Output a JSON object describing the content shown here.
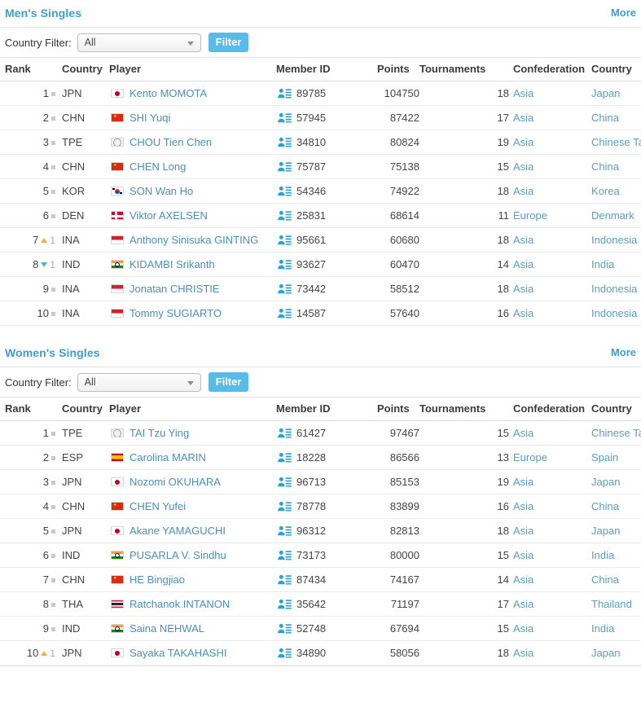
{
  "columns": [
    "Rank",
    "Country",
    "Player",
    "Member ID",
    "Points",
    "Tournaments",
    "Confederation",
    "Country"
  ],
  "filter": {
    "label": "Country Filter:",
    "selected": "All",
    "button": "Filter"
  },
  "icons": {
    "member_id": "id-card-icon",
    "dropdown": "chevron-down-icon"
  },
  "colors": {
    "accent": "#3a9fd4",
    "link": "#4a8fb8",
    "button": "#59bce8",
    "up": "#f0ad4e",
    "down": "#4ab5d1",
    "same": "#c9c9c9"
  },
  "sections": [
    {
      "title": "Men's Singles",
      "more": "More",
      "rows": [
        {
          "rank": "1",
          "move": "same",
          "amount": "",
          "code": "JPN",
          "flag": "jp",
          "player": "Kento MOMOTA",
          "member_id": "89785",
          "points": "104750",
          "tournaments": "18",
          "confederation": "Asia",
          "country": "Japan"
        },
        {
          "rank": "2",
          "move": "same",
          "amount": "",
          "code": "CHN",
          "flag": "cn",
          "player": "SHI Yuqi",
          "member_id": "57945",
          "points": "87422",
          "tournaments": "17",
          "confederation": "Asia",
          "country": "China"
        },
        {
          "rank": "3",
          "move": "same",
          "amount": "",
          "code": "TPE",
          "flag": "tw",
          "player": "CHOU Tien Chen",
          "member_id": "34810",
          "points": "80824",
          "tournaments": "19",
          "confederation": "Asia",
          "country": "Chinese Taipei"
        },
        {
          "rank": "4",
          "move": "same",
          "amount": "",
          "code": "CHN",
          "flag": "cn",
          "player": "CHEN Long",
          "member_id": "75787",
          "points": "75138",
          "tournaments": "15",
          "confederation": "Asia",
          "country": "China"
        },
        {
          "rank": "5",
          "move": "same",
          "amount": "",
          "code": "KOR",
          "flag": "kr",
          "player": "SON Wan Ho",
          "member_id": "54346",
          "points": "74922",
          "tournaments": "18",
          "confederation": "Asia",
          "country": "Korea"
        },
        {
          "rank": "6",
          "move": "same",
          "amount": "",
          "code": "DEN",
          "flag": "dk",
          "player": "Viktor AXELSEN",
          "member_id": "25831",
          "points": "68614",
          "tournaments": "11",
          "confederation": "Europe",
          "country": "Denmark"
        },
        {
          "rank": "7",
          "move": "up",
          "amount": "1",
          "code": "INA",
          "flag": "id",
          "player": "Anthony Sinisuka GINTING",
          "member_id": "95661",
          "points": "60680",
          "tournaments": "18",
          "confederation": "Asia",
          "country": "Indonesia"
        },
        {
          "rank": "8",
          "move": "down",
          "amount": "1",
          "code": "IND",
          "flag": "in",
          "player": "KIDAMBI Srikanth",
          "member_id": "93627",
          "points": "60470",
          "tournaments": "14",
          "confederation": "Asia",
          "country": "India"
        },
        {
          "rank": "9",
          "move": "same",
          "amount": "",
          "code": "INA",
          "flag": "id",
          "player": "Jonatan CHRISTIE",
          "member_id": "73442",
          "points": "58512",
          "tournaments": "18",
          "confederation": "Asia",
          "country": "Indonesia"
        },
        {
          "rank": "10",
          "move": "same",
          "amount": "",
          "code": "INA",
          "flag": "id",
          "player": "Tommy SUGIARTO",
          "member_id": "14587",
          "points": "57640",
          "tournaments": "16",
          "confederation": "Asia",
          "country": "Indonesia"
        }
      ]
    },
    {
      "title": "Women's Singles",
      "more": "More",
      "rows": [
        {
          "rank": "1",
          "move": "same",
          "amount": "",
          "code": "TPE",
          "flag": "tw",
          "player": "TAI Tzu Ying",
          "member_id": "61427",
          "points": "97467",
          "tournaments": "15",
          "confederation": "Asia",
          "country": "Chinese Taipei"
        },
        {
          "rank": "2",
          "move": "same",
          "amount": "",
          "code": "ESP",
          "flag": "es",
          "player": "Carolina MARIN",
          "member_id": "18228",
          "points": "86566",
          "tournaments": "13",
          "confederation": "Europe",
          "country": "Spain"
        },
        {
          "rank": "3",
          "move": "same",
          "amount": "",
          "code": "JPN",
          "flag": "jp",
          "player": "Nozomi OKUHARA",
          "member_id": "96713",
          "points": "85153",
          "tournaments": "19",
          "confederation": "Asia",
          "country": "Japan"
        },
        {
          "rank": "4",
          "move": "same",
          "amount": "",
          "code": "CHN",
          "flag": "cn",
          "player": "CHEN Yufei",
          "member_id": "78778",
          "points": "83899",
          "tournaments": "16",
          "confederation": "Asia",
          "country": "China"
        },
        {
          "rank": "5",
          "move": "same",
          "amount": "",
          "code": "JPN",
          "flag": "jp",
          "player": "Akane YAMAGUCHI",
          "member_id": "96312",
          "points": "82813",
          "tournaments": "18",
          "confederation": "Asia",
          "country": "Japan"
        },
        {
          "rank": "6",
          "move": "same",
          "amount": "",
          "code": "IND",
          "flag": "in",
          "player": "PUSARLA V. Sindhu",
          "member_id": "73173",
          "points": "80000",
          "tournaments": "15",
          "confederation": "Asia",
          "country": "India"
        },
        {
          "rank": "7",
          "move": "same",
          "amount": "",
          "code": "CHN",
          "flag": "cn",
          "player": "HE Bingjiao",
          "member_id": "87434",
          "points": "74167",
          "tournaments": "14",
          "confederation": "Asia",
          "country": "China"
        },
        {
          "rank": "8",
          "move": "same",
          "amount": "",
          "code": "THA",
          "flag": "th",
          "player": "Ratchanok INTANON",
          "member_id": "35642",
          "points": "71197",
          "tournaments": "17",
          "confederation": "Asia",
          "country": "Thailand"
        },
        {
          "rank": "9",
          "move": "same",
          "amount": "",
          "code": "IND",
          "flag": "in",
          "player": "Saina NEHWAL",
          "member_id": "52748",
          "points": "67694",
          "tournaments": "15",
          "confederation": "Asia",
          "country": "India"
        },
        {
          "rank": "10",
          "move": "up",
          "amount": "1",
          "code": "JPN",
          "flag": "jp",
          "player": "Sayaka TAKAHASHI",
          "member_id": "34890",
          "points": "58056",
          "tournaments": "18",
          "confederation": "Asia",
          "country": "Japan"
        }
      ]
    }
  ]
}
